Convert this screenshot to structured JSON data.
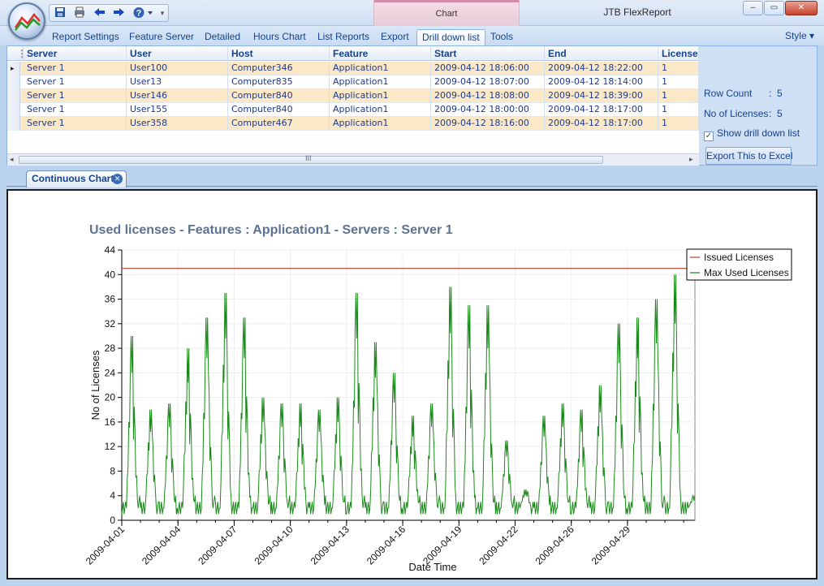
{
  "window": {
    "title": "JTB FlexReport",
    "context_group": "Chart",
    "controls": {
      "minimize": "–",
      "maximize": "▭",
      "close": "✕"
    }
  },
  "qat": {
    "icons": [
      "save-icon",
      "print-icon",
      "back-arrow-icon",
      "forward-arrow-icon",
      "help-icon",
      "customize-icon"
    ]
  },
  "ribbon": {
    "tabs": [
      {
        "label": "Report Settings"
      },
      {
        "label": "Feature Server"
      },
      {
        "label": "Detailed"
      },
      {
        "label": "Hours Chart"
      },
      {
        "label": "List Reports"
      },
      {
        "label": "Export"
      },
      {
        "label": "Drill down list",
        "active": true
      },
      {
        "label": "Tools"
      }
    ],
    "style_label": "Style ▾"
  },
  "grid": {
    "columns": [
      "Server",
      "User",
      "Host",
      "Feature",
      "Start",
      "End",
      "License"
    ],
    "rows": [
      [
        "Server 1",
        "User100",
        "Computer346",
        "Application1",
        "2009-04-12 18:06:00",
        "2009-04-12 18:22:00",
        "1"
      ],
      [
        "Server 1",
        "User13",
        "Computer835",
        "Application1",
        "2009-04-12 18:07:00",
        "2009-04-12 18:14:00",
        "1"
      ],
      [
        "Server 1",
        "User146",
        "Computer840",
        "Application1",
        "2009-04-12 18:08:00",
        "2009-04-12 18:39:00",
        "1"
      ],
      [
        "Server 1",
        "User155",
        "Computer840",
        "Application1",
        "2009-04-12 18:00:00",
        "2009-04-12 18:17:00",
        "1"
      ],
      [
        "Server 1",
        "User358",
        "Computer467",
        "Application1",
        "2009-04-12 18:16:00",
        "2009-04-12 18:17:00",
        "1"
      ]
    ],
    "scroll_grip": "III"
  },
  "side_info": {
    "row_count_label": "Row Count",
    "row_count_value": "5",
    "licenses_label": "No of Licenses",
    "licenses_value": "5",
    "separator": ":",
    "show_drill_label": "Show drill down list",
    "show_drill_checked": true,
    "export_button": "Export This to Excel"
  },
  "doc_tab": {
    "label": "Continuous Chart",
    "close": "✕"
  },
  "chart_data": {
    "type": "line",
    "title": "Used licenses - Features : Application1 - Servers : Server 1",
    "xlabel": "Date Time",
    "ylabel": "No of Licenses",
    "ylim": [
      0,
      44
    ],
    "yticks": [
      0,
      4,
      8,
      12,
      16,
      20,
      24,
      28,
      32,
      36,
      40,
      44
    ],
    "xlim_days": [
      0,
      30.6
    ],
    "xticks": [
      {
        "label": "2009-04-01",
        "day": 0
      },
      {
        "label": "2009-04-04",
        "day": 3
      },
      {
        "label": "2009-04-07",
        "day": 6
      },
      {
        "label": "2009-04-10",
        "day": 9
      },
      {
        "label": "2009-04-13",
        "day": 12
      },
      {
        "label": "2009-04-16",
        "day": 15
      },
      {
        "label": "2009-04-19",
        "day": 18
      },
      {
        "label": "2009-04-22",
        "day": 21
      },
      {
        "label": "2009-04-26",
        "day": 24
      },
      {
        "label": "2009-04-29",
        "day": 27
      }
    ],
    "grid": true,
    "legend_position": "top-right",
    "series": [
      {
        "name": "Issued Licenses",
        "color": "#c0392b",
        "constant": 41
      },
      {
        "name": "Max Used Licenses",
        "color": "#1a8a1a",
        "daily_peaks": [
          30,
          18,
          19,
          28,
          33,
          37,
          33,
          20,
          19,
          19,
          18,
          20,
          37,
          29,
          24,
          17,
          19,
          38,
          35,
          35,
          13,
          5,
          17,
          19,
          18,
          22,
          32,
          33,
          36,
          40,
          4
        ]
      }
    ]
  }
}
